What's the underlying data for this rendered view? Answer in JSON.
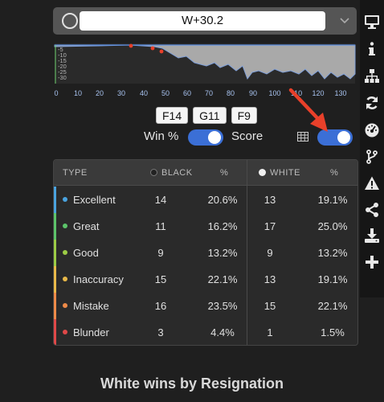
{
  "score": {
    "value": "W+30.2"
  },
  "graph": {
    "y_ticks": [
      "-5",
      "-10",
      "-15",
      "-20",
      "-25",
      "-30"
    ],
    "x_ticks": [
      "0",
      "10",
      "20",
      "30",
      "40",
      "50",
      "60",
      "70",
      "80",
      "90",
      "100",
      "110",
      "120",
      "130"
    ]
  },
  "moves": [
    "F14",
    "G11",
    "F9"
  ],
  "toggles": {
    "win_label": "Win %",
    "score_label": "Score"
  },
  "table": {
    "headers": {
      "type": "TYPE",
      "black": "BLACK",
      "black_pct": "%",
      "white": "WHITE",
      "white_pct": "%"
    },
    "rows": [
      {
        "type": "Excellent",
        "black": "14",
        "black_pct": "20.6%",
        "white": "13",
        "white_pct": "19.1%",
        "color": "#4aa3df"
      },
      {
        "type": "Great",
        "black": "11",
        "black_pct": "16.2%",
        "white": "17",
        "white_pct": "25.0%",
        "color": "#5cc46a"
      },
      {
        "type": "Good",
        "black": "9",
        "black_pct": "13.2%",
        "white": "9",
        "white_pct": "13.2%",
        "color": "#9ccc45"
      },
      {
        "type": "Inaccuracy",
        "black": "15",
        "black_pct": "22.1%",
        "white": "13",
        "white_pct": "19.1%",
        "color": "#e9b949"
      },
      {
        "type": "Mistake",
        "black": "16",
        "black_pct": "23.5%",
        "white": "15",
        "white_pct": "22.1%",
        "color": "#ee8a48"
      },
      {
        "type": "Blunder",
        "black": "3",
        "black_pct": "4.4%",
        "white": "1",
        "white_pct": "1.5%",
        "color": "#e04848"
      }
    ]
  },
  "result": "White wins by Resignation",
  "colors": {
    "accent": "#3b6fd6",
    "arrow": "#e8402a"
  },
  "toolbar_icons": [
    "monitor-icon",
    "info-icon",
    "sitemap-icon",
    "refresh-icon",
    "gauge-icon",
    "branch-icon",
    "warning-icon",
    "share-icon",
    "download-icon",
    "plus-icon"
  ]
}
